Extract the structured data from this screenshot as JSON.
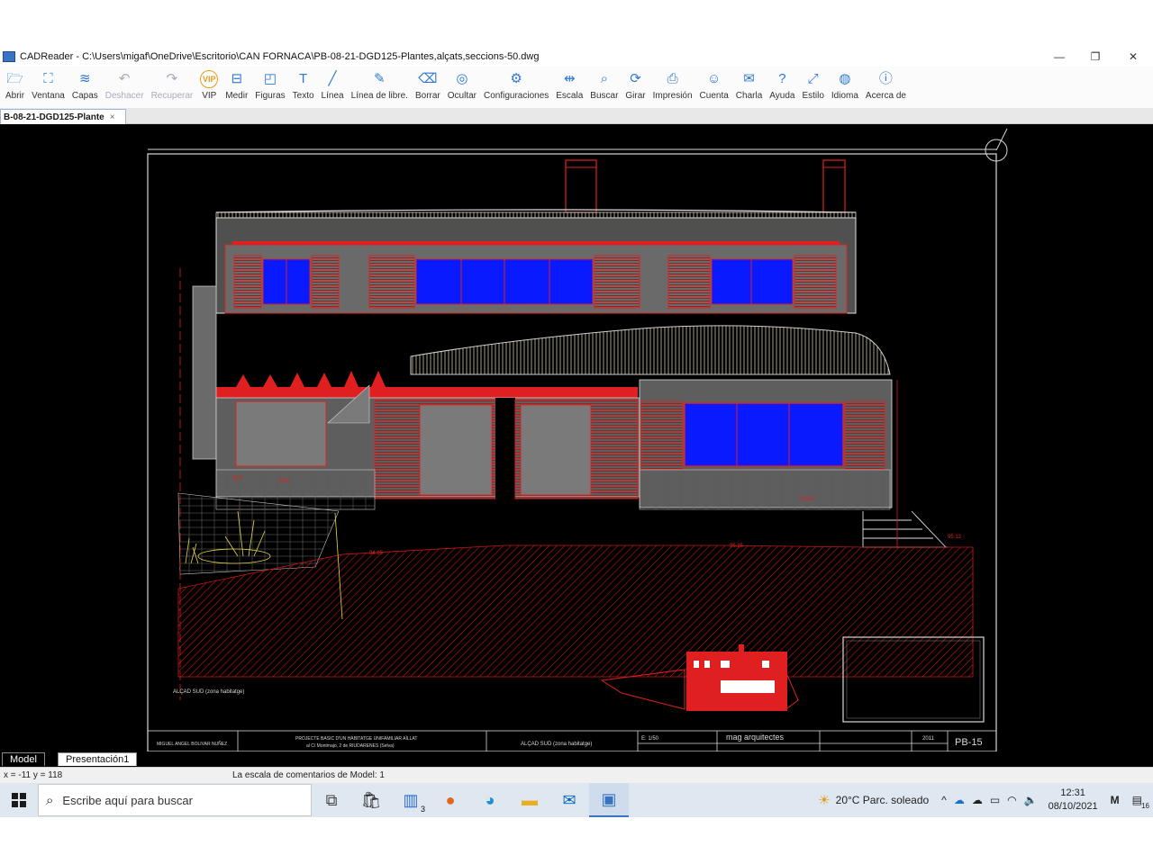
{
  "window": {
    "title": "CADReader - C:\\Users\\migaf\\OneDrive\\Escritorio\\CAN FORNACA\\PB-08-21-DGD125-Plantes,alçats,seccions-50.dwg"
  },
  "toolbar": [
    {
      "id": "abrir",
      "label": "Abrir",
      "icon": "folder-icon",
      "glyph": "🗁"
    },
    {
      "id": "ventana",
      "label": "Ventana",
      "icon": "window-icon",
      "glyph": "⛶"
    },
    {
      "id": "capas",
      "label": "Capas",
      "icon": "layers-icon",
      "glyph": "≋"
    },
    {
      "id": "deshacer",
      "label": "Deshacer",
      "icon": "undo-icon",
      "glyph": "↶",
      "disabled": true
    },
    {
      "id": "recuperar",
      "label": "Recuperar",
      "icon": "redo-icon",
      "glyph": "↷",
      "disabled": true
    },
    {
      "id": "vip",
      "label": "VIP",
      "icon": "vip-icon",
      "glyph": "VIP",
      "vip": true
    },
    {
      "id": "medir",
      "label": "Medir",
      "icon": "ruler-icon",
      "glyph": "⊟"
    },
    {
      "id": "figuras",
      "label": "Figuras",
      "icon": "shapes-icon",
      "glyph": "◰"
    },
    {
      "id": "texto",
      "label": "Texto",
      "icon": "text-icon",
      "glyph": "T"
    },
    {
      "id": "linea",
      "label": "Línea",
      "icon": "line-icon",
      "glyph": "╱"
    },
    {
      "id": "linea-libre",
      "label": "Línea de libre.",
      "icon": "pencil-icon",
      "glyph": "✎"
    },
    {
      "id": "borrar",
      "label": "Borrar",
      "icon": "eraser-icon",
      "glyph": "⌫"
    },
    {
      "id": "ocultar",
      "label": "Ocultar",
      "icon": "eye-off-icon",
      "glyph": "◎"
    },
    {
      "id": "config",
      "label": "Configuraciones",
      "icon": "settings-icon",
      "glyph": "⚙"
    },
    {
      "id": "escala",
      "label": "Escala",
      "icon": "scale-icon",
      "glyph": "⇹"
    },
    {
      "id": "buscar",
      "label": "Buscar",
      "icon": "search-icon",
      "glyph": "⌕"
    },
    {
      "id": "girar",
      "label": "Girar",
      "icon": "rotate-icon",
      "glyph": "⟳"
    },
    {
      "id": "impresion",
      "label": "Impresión",
      "icon": "printer-icon",
      "glyph": "⎙"
    },
    {
      "id": "cuenta",
      "label": "Cuenta",
      "icon": "user-icon",
      "glyph": "☺"
    },
    {
      "id": "charla",
      "label": "Charla",
      "icon": "chat-icon",
      "glyph": "✉"
    },
    {
      "id": "ayuda",
      "label": "Ayuda",
      "icon": "help-icon",
      "glyph": "?"
    },
    {
      "id": "estilo",
      "label": "Estilo",
      "icon": "style-icon",
      "glyph": "⤢"
    },
    {
      "id": "idioma",
      "label": "Idioma",
      "icon": "globe-icon",
      "glyph": "◍"
    },
    {
      "id": "acerca",
      "label": "Acerca de",
      "icon": "info-icon",
      "glyph": "ⓘ"
    }
  ],
  "document_tab": {
    "label": "B-08-21-DGD125-Plante",
    "close": "×"
  },
  "drawing": {
    "caption": "ALÇAD SUD (zona habitatge)",
    "sheet_number": "PB-15",
    "title_block": {
      "author": "MIGUEL ANGEL BOLIVAR NUÑEZ",
      "project_line1": "PROJECTE BASIC D'UN HABITATGE UNIFAMILIAR AÏLLAT",
      "project_line2": "al C/ Montmajo, 2  de RIUDARENES (Selva)",
      "sheet_title": "ALÇAD SUD (zona habitatge)",
      "scale": "E: 1/50",
      "firm": "mag  arquitectes",
      "year": "2011"
    }
  },
  "layout_tabs": {
    "model": "Model",
    "presentation": "Presentación1"
  },
  "status": {
    "coords": "x = -11 y = 118",
    "message": "La escala de comentarios de Model: 1"
  },
  "taskbar": {
    "search_placeholder": "Escribe aquí para buscar",
    "weather": "20°C  Parc. soleado",
    "time": "12:31",
    "date": "08/10/2021",
    "notif_count": "16",
    "badge_count": "3"
  },
  "colors": {
    "cad_red": "#e02020",
    "cad_blue": "#0a1aff",
    "cad_yellow": "#e6d84a",
    "cad_bg": "#000000"
  }
}
